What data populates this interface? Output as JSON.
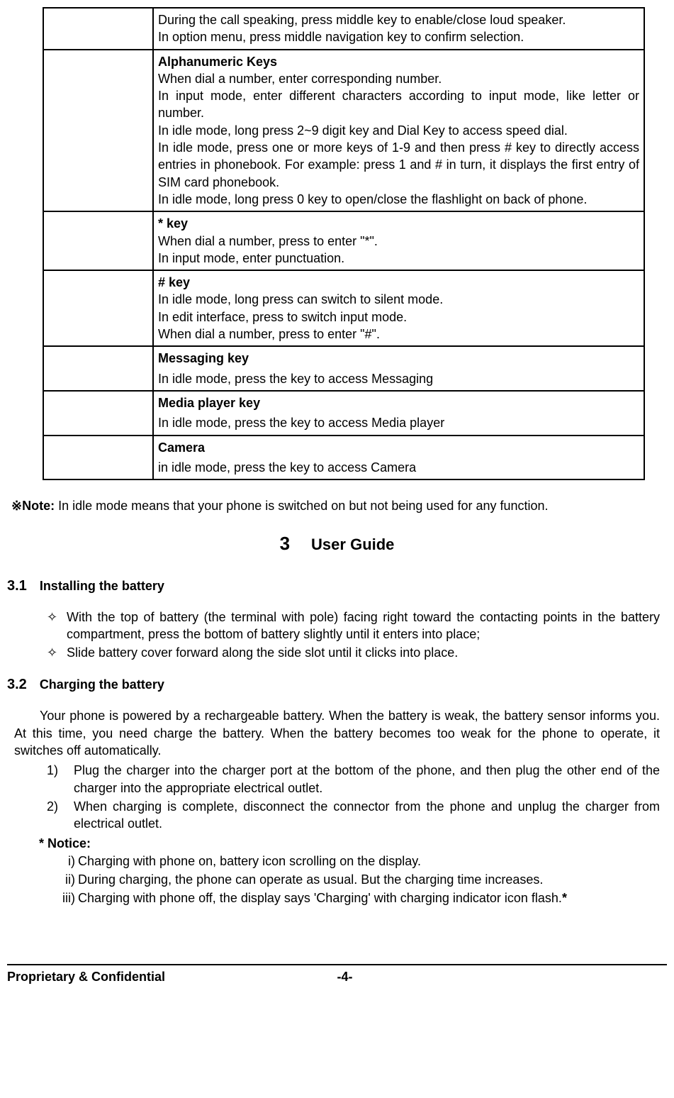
{
  "table": {
    "row0": "During the call speaking, press middle key to enable/close loud speaker.\nIn option menu, press middle navigation key to confirm selection.",
    "row1_title": "Alphanumeric Keys",
    "row1_body": "When dial a number, enter corresponding number.\nIn input mode, enter different characters according to input mode, like letter or number.\nIn idle mode, long press 2~9 digit key and Dial Key to access speed dial.\nIn idle mode, press one or more keys of 1-9 and then press # key to directly access entries in phonebook. For example: press 1 and # in turn, it displays the first entry of SIM card phonebook.\nIn idle mode, long press 0 key to open/close the flashlight on back of phone.",
    "row2_title": "* key",
    "row2_body": "When dial a number, press to enter \"*\".\nIn input mode, enter punctuation.",
    "row3_title": "# key",
    "row3_body": "In idle mode, long press can switch to silent mode.\nIn edit interface, press to switch input mode.\nWhen dial a number, press to enter \"#\".",
    "row4_title": "Messaging key",
    "row4_body": "In idle mode, press the key to access Messaging",
    "row5_title": "Media player key",
    "row5_body": "In idle mode, press the key to access Media player",
    "row6_title": "Camera",
    "row6_body": "in idle mode, press the key to access Camera"
  },
  "note_prefix": "※Note: ",
  "note_text": "In idle mode means that your phone is switched on but not being used for any function.",
  "sec3_num": "3",
  "sec3_title": "User Guide",
  "sub31_num": "3.1",
  "sub31_title": "Installing the battery",
  "bullets31": {
    "b1": "With the top of battery (the terminal with pole) facing right toward the contacting points in the battery compartment, press the bottom of battery slightly until it enters into place;",
    "b2": "Slide battery cover forward along the side slot until it clicks into place."
  },
  "sub32_num": "3.2",
  "sub32_title": "Charging the battery",
  "para32": "Your phone is powered by a rechargeable battery. When the battery is weak, the battery sensor informs you. At this time, you need charge the battery. When the battery becomes too weak for the phone to operate, it switches off automatically.",
  "numlist32": {
    "n1": "Plug the charger into the charger port at the bottom of the phone, and then plug the other end of the charger into the appropriate electrical outlet.",
    "n2": "When charging is complete, disconnect the connector from the phone and unplug the charger from electrical outlet."
  },
  "notice_label": "* Notice:",
  "roman": {
    "r1": "Charging with phone on, battery icon scrolling on the display.",
    "r2": "During charging, the phone can operate as usual. But the charging time increases.",
    "r3_pre": "Charging with phone off, the display says 'Charging' with charging indicator icon flash.",
    "r3_suf": "*"
  },
  "footer_left": "Proprietary & Confidential",
  "footer_center": "-4-"
}
